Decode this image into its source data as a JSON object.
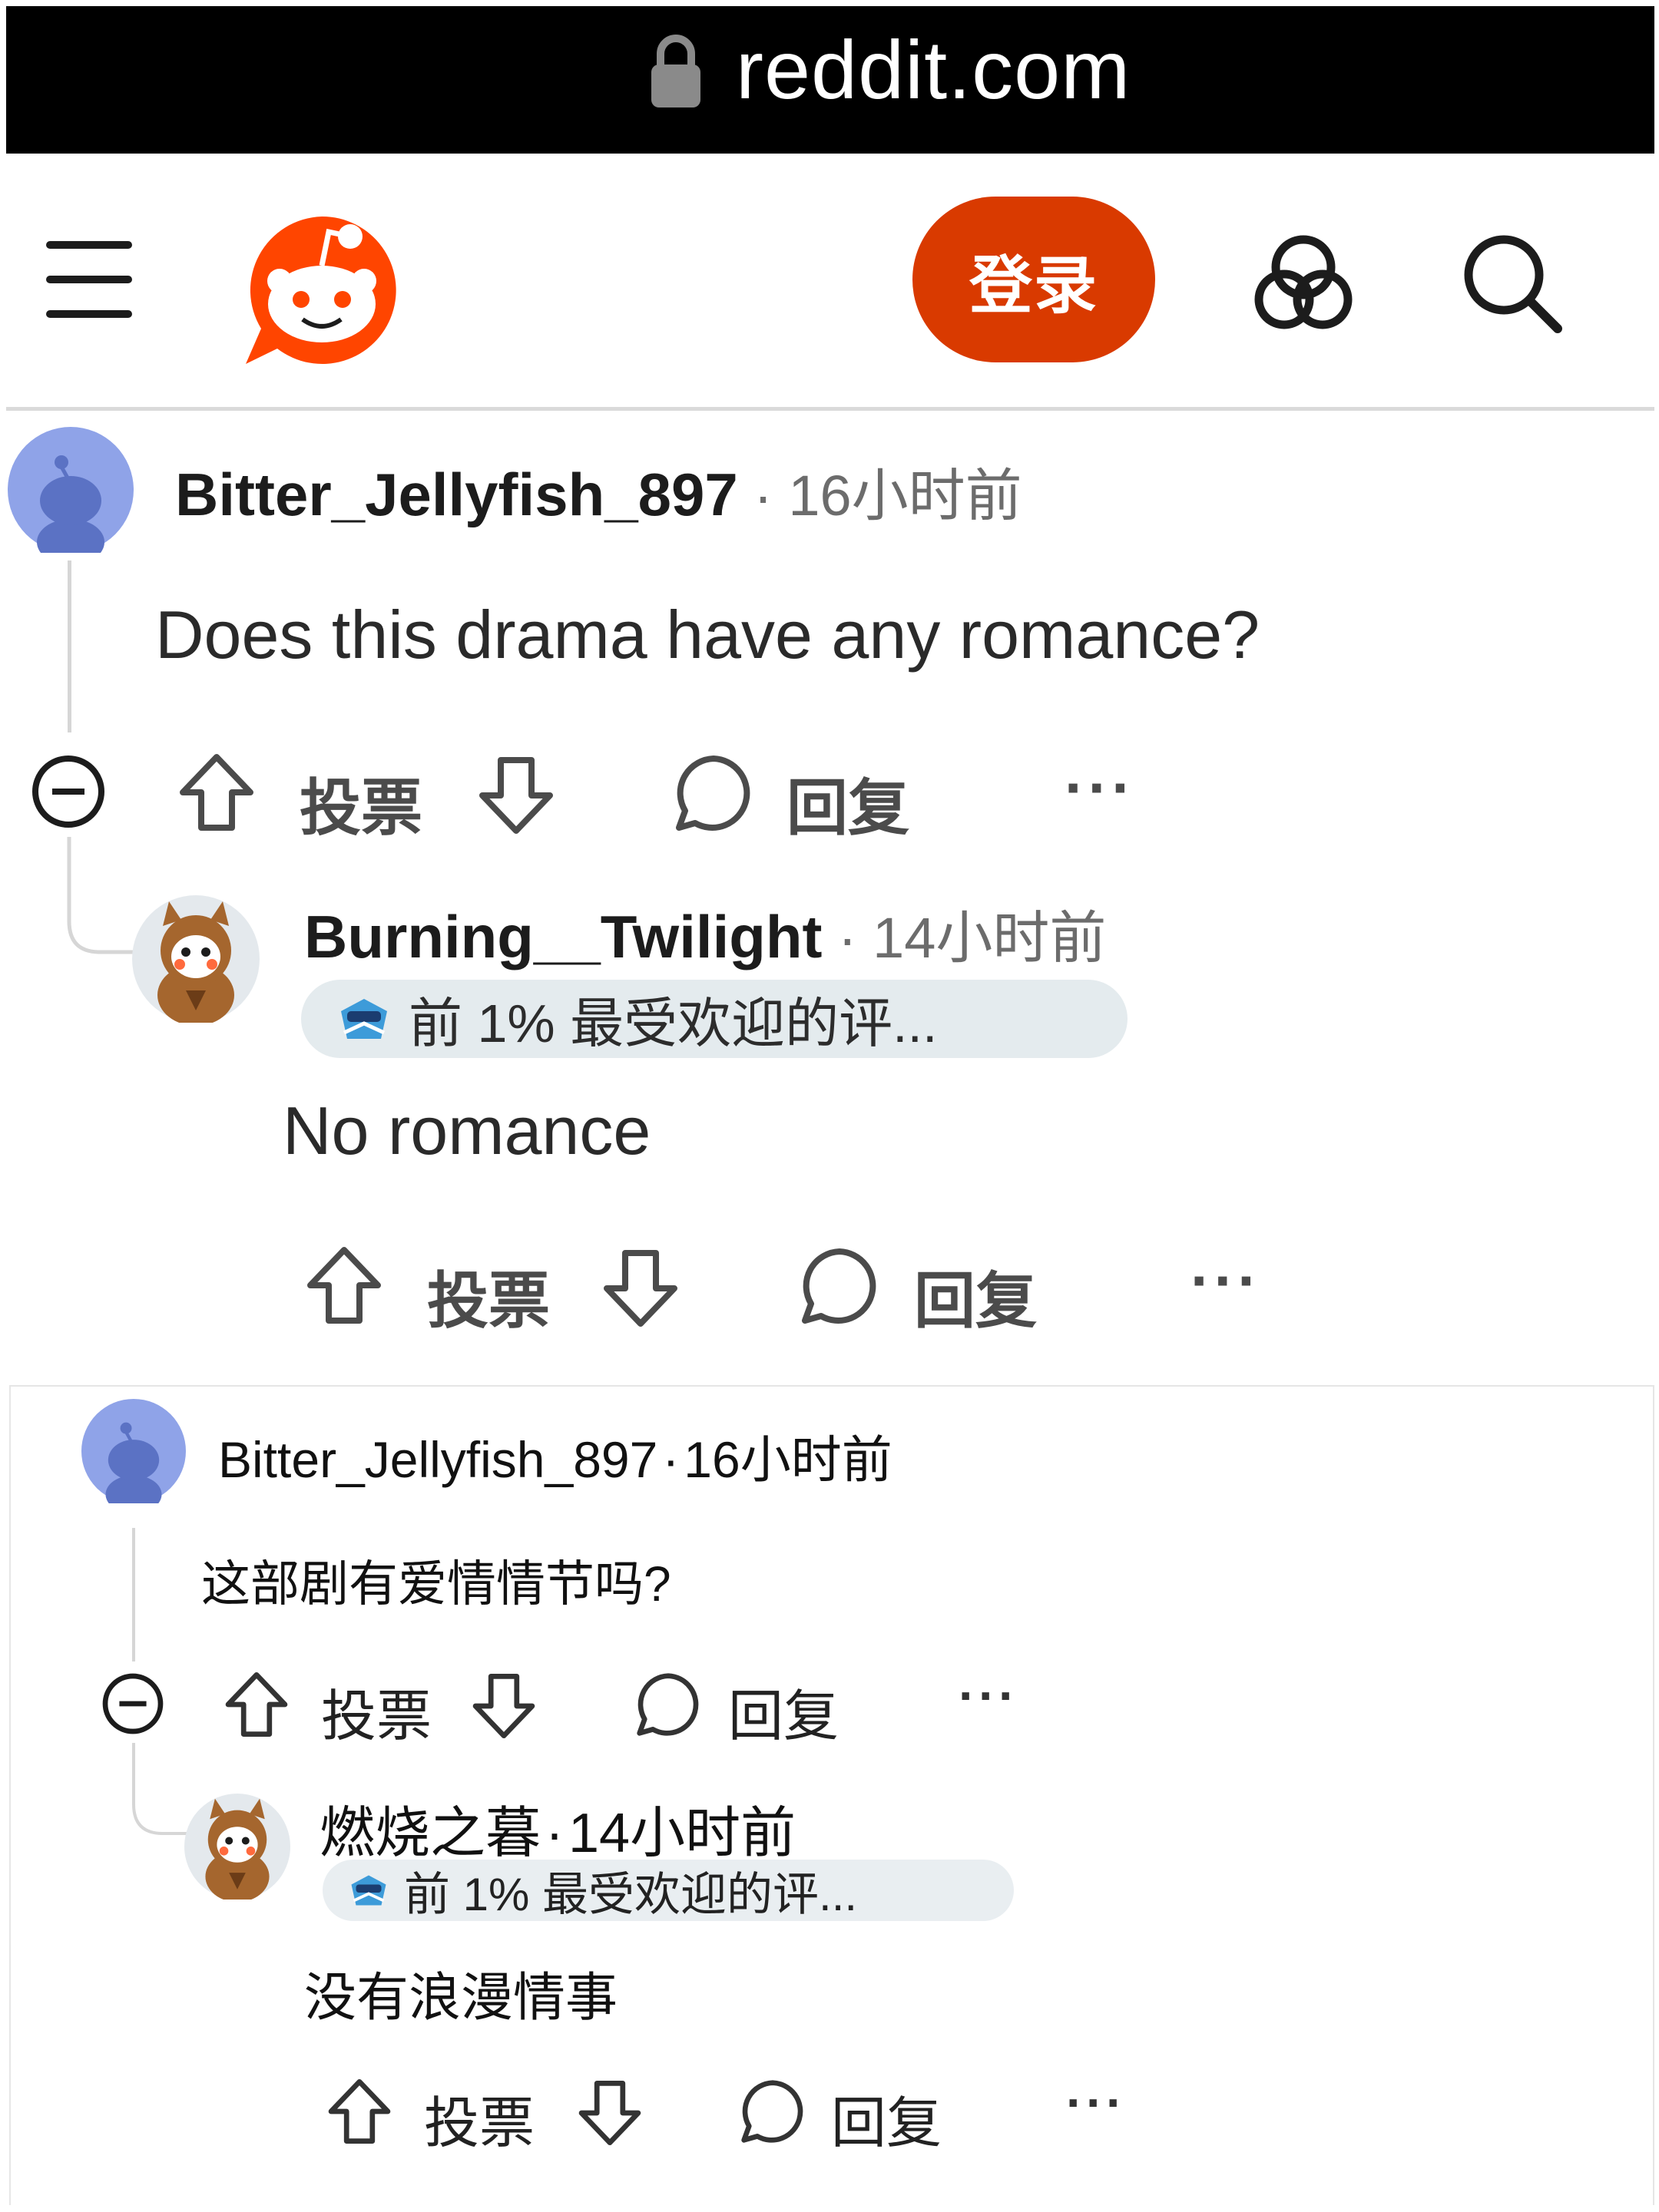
{
  "browser": {
    "url": "reddit.com"
  },
  "header": {
    "login_label": "登录"
  },
  "colors": {
    "accent": "#d93a00",
    "brand": "#ff4500",
    "flair_bg": "#e4ebee"
  },
  "comments_en": [
    {
      "username": "Bitter_Jellyfish_897",
      "time": "16小时前",
      "body": "Does this drama have any romance?",
      "vote_label": "投票",
      "reply_label": "回复",
      "more": "···"
    },
    {
      "username": "Burning__Twilight",
      "time": "14小时前",
      "flair": "前 1% 最受欢迎的评...",
      "body": "No romance",
      "vote_label": "投票",
      "reply_label": "回复",
      "more": "···"
    }
  ],
  "comments_zh": [
    {
      "username": "Bitter_Jellyfish_897",
      "time": "16小时前",
      "body": "这部剧有爱情情节吗?",
      "vote_label": "投票",
      "reply_label": "回复",
      "more": "···"
    },
    {
      "username": "燃烧之暮",
      "time": "14小时前",
      "flair": "前 1% 最受欢迎的评...",
      "body": "没有浪漫情事",
      "vote_label": "投票",
      "reply_label": "回复",
      "more": "···"
    }
  ],
  "separator": "·"
}
